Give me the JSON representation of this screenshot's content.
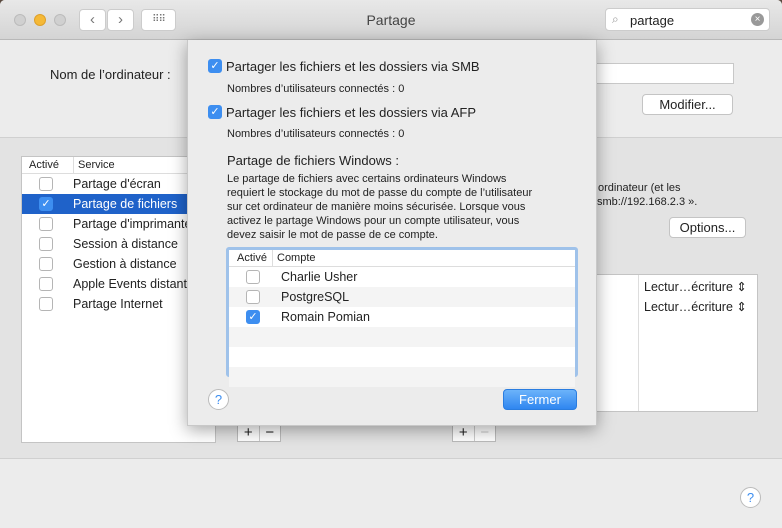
{
  "window": {
    "title": "Partage",
    "search_value": "partage"
  },
  "computer_name": {
    "label": "Nom de l’ordinateur :",
    "modify_button": "Modifier..."
  },
  "services": {
    "headers": [
      "Activé",
      "Service"
    ],
    "items": [
      {
        "label": "Partage d'écran",
        "checked": false,
        "selected": false
      },
      {
        "label": "Partage de fichiers",
        "checked": true,
        "selected": true
      },
      {
        "label": "Partage d'imprimante",
        "checked": false,
        "selected": false
      },
      {
        "label": "Session à distance",
        "checked": false,
        "selected": false
      },
      {
        "label": "Gestion à distance",
        "checked": false,
        "selected": false
      },
      {
        "label": "Apple Events distants",
        "checked": false,
        "selected": false
      },
      {
        "label": "Partage Internet",
        "checked": false,
        "selected": false
      }
    ]
  },
  "right": {
    "desc_line1": "ordinateur (et les",
    "desc_line2": "smb://192.168.2.3 ».",
    "options_button": "Options...",
    "permissions": [
      "Lectur…écriture",
      "Lectur…écriture"
    ]
  },
  "sheet": {
    "smb_label": "Partager les fichiers et les dossiers via SMB",
    "smb_checked": true,
    "smb_users": "Nombres d’utilisateurs connectés : 0",
    "afp_label": "Partager les fichiers et les dossiers via AFP",
    "afp_checked": true,
    "afp_users": "Nombres d’utilisateurs connectés : 0",
    "windows_title": "Partage de fichiers Windows :",
    "windows_desc": [
      "Le partage de fichiers avec certains ordinateurs Windows",
      "requiert le stockage du mot de passe du compte de l’utilisateur",
      "sur cet ordinateur de manière moins sécurisée. Lorsque vous",
      "activez le partage Windows pour un compte utilisateur, vous",
      "devez saisir le mot de passe de ce compte."
    ],
    "accounts_headers": [
      "Activé",
      "Compte"
    ],
    "accounts": [
      {
        "name": "Charlie Usher",
        "checked": false
      },
      {
        "name": "PostgreSQL",
        "checked": false
      },
      {
        "name": "Romain Pomian",
        "checked": true
      }
    ],
    "close_button": "Fermer"
  },
  "colors": {
    "accent": "#3d8ef0",
    "selection": "#1f62c9"
  }
}
